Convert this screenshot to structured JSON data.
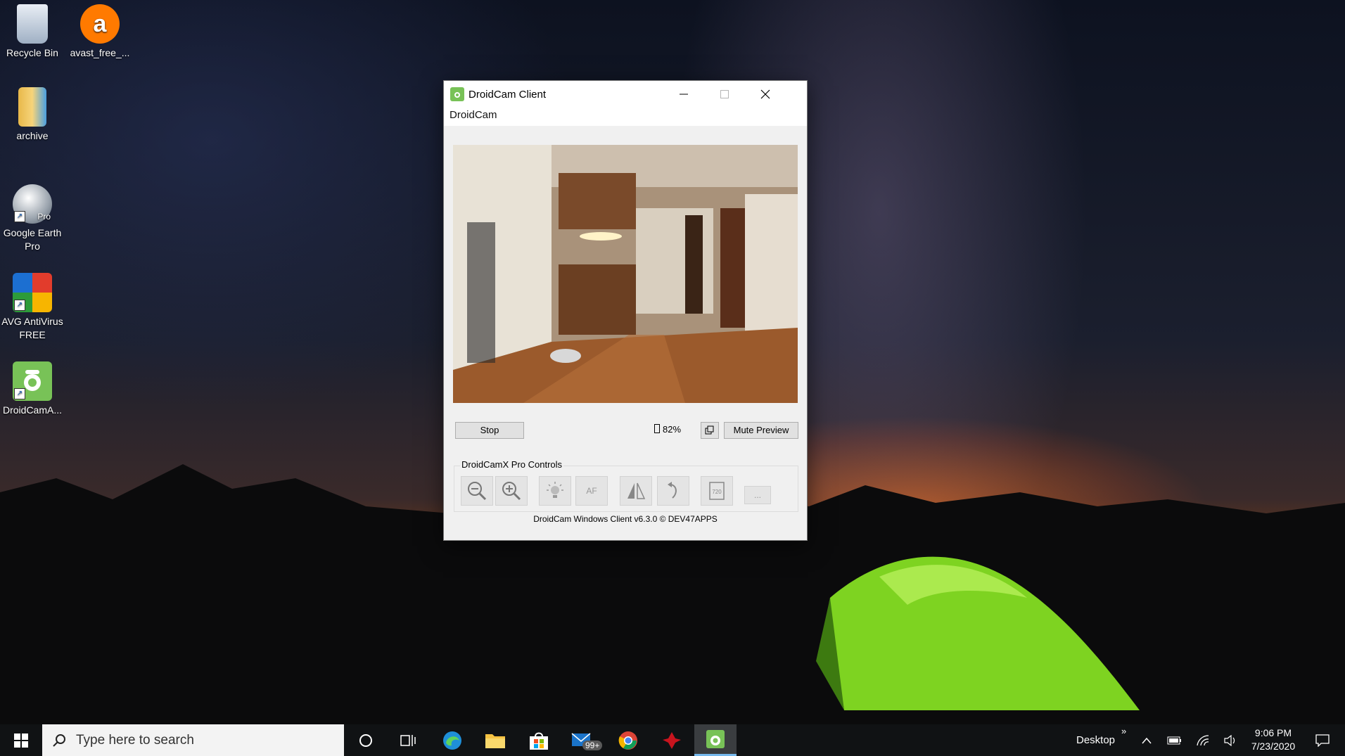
{
  "desktop": {
    "icons": [
      {
        "label": "Recycle Bin"
      },
      {
        "label": "avast_free_..."
      },
      {
        "label": "archive"
      },
      {
        "label": "Google Earth Pro",
        "badge": "Pro"
      },
      {
        "label": "AVG AntiVirus FREE"
      },
      {
        "label": "DroidCamA..."
      }
    ]
  },
  "window": {
    "title": "DroidCam Client",
    "menu_item": "DroidCam",
    "stop_label": "Stop",
    "battery_text": "82%",
    "mute_label": "Mute Preview",
    "group_label": "DroidCamX Pro Controls",
    "tools": [
      {
        "icon": "zoom-out-icon"
      },
      {
        "icon": "zoom-in-icon"
      },
      {
        "icon": "brightness-icon"
      },
      {
        "icon": "autofocus-icon",
        "label": "AF"
      },
      {
        "icon": "mirror-icon"
      },
      {
        "icon": "rotate-icon"
      },
      {
        "icon": "resolution-icon",
        "label": "720"
      },
      {
        "icon": "more-icon",
        "label": "..."
      }
    ],
    "footer": "DroidCam Windows Client v6.3.0 © DEV47APPS"
  },
  "taskbar": {
    "search_placeholder": "Type here to search",
    "mail_badge": "99+",
    "desktop_label": "Desktop",
    "time": "9:06 PM",
    "date": "7/23/2020"
  },
  "colors": {
    "taskbar": "#101214",
    "window_bg": "#f0f0f0",
    "droidcam_green": "#78c257",
    "tent_green": "#7ed321"
  }
}
